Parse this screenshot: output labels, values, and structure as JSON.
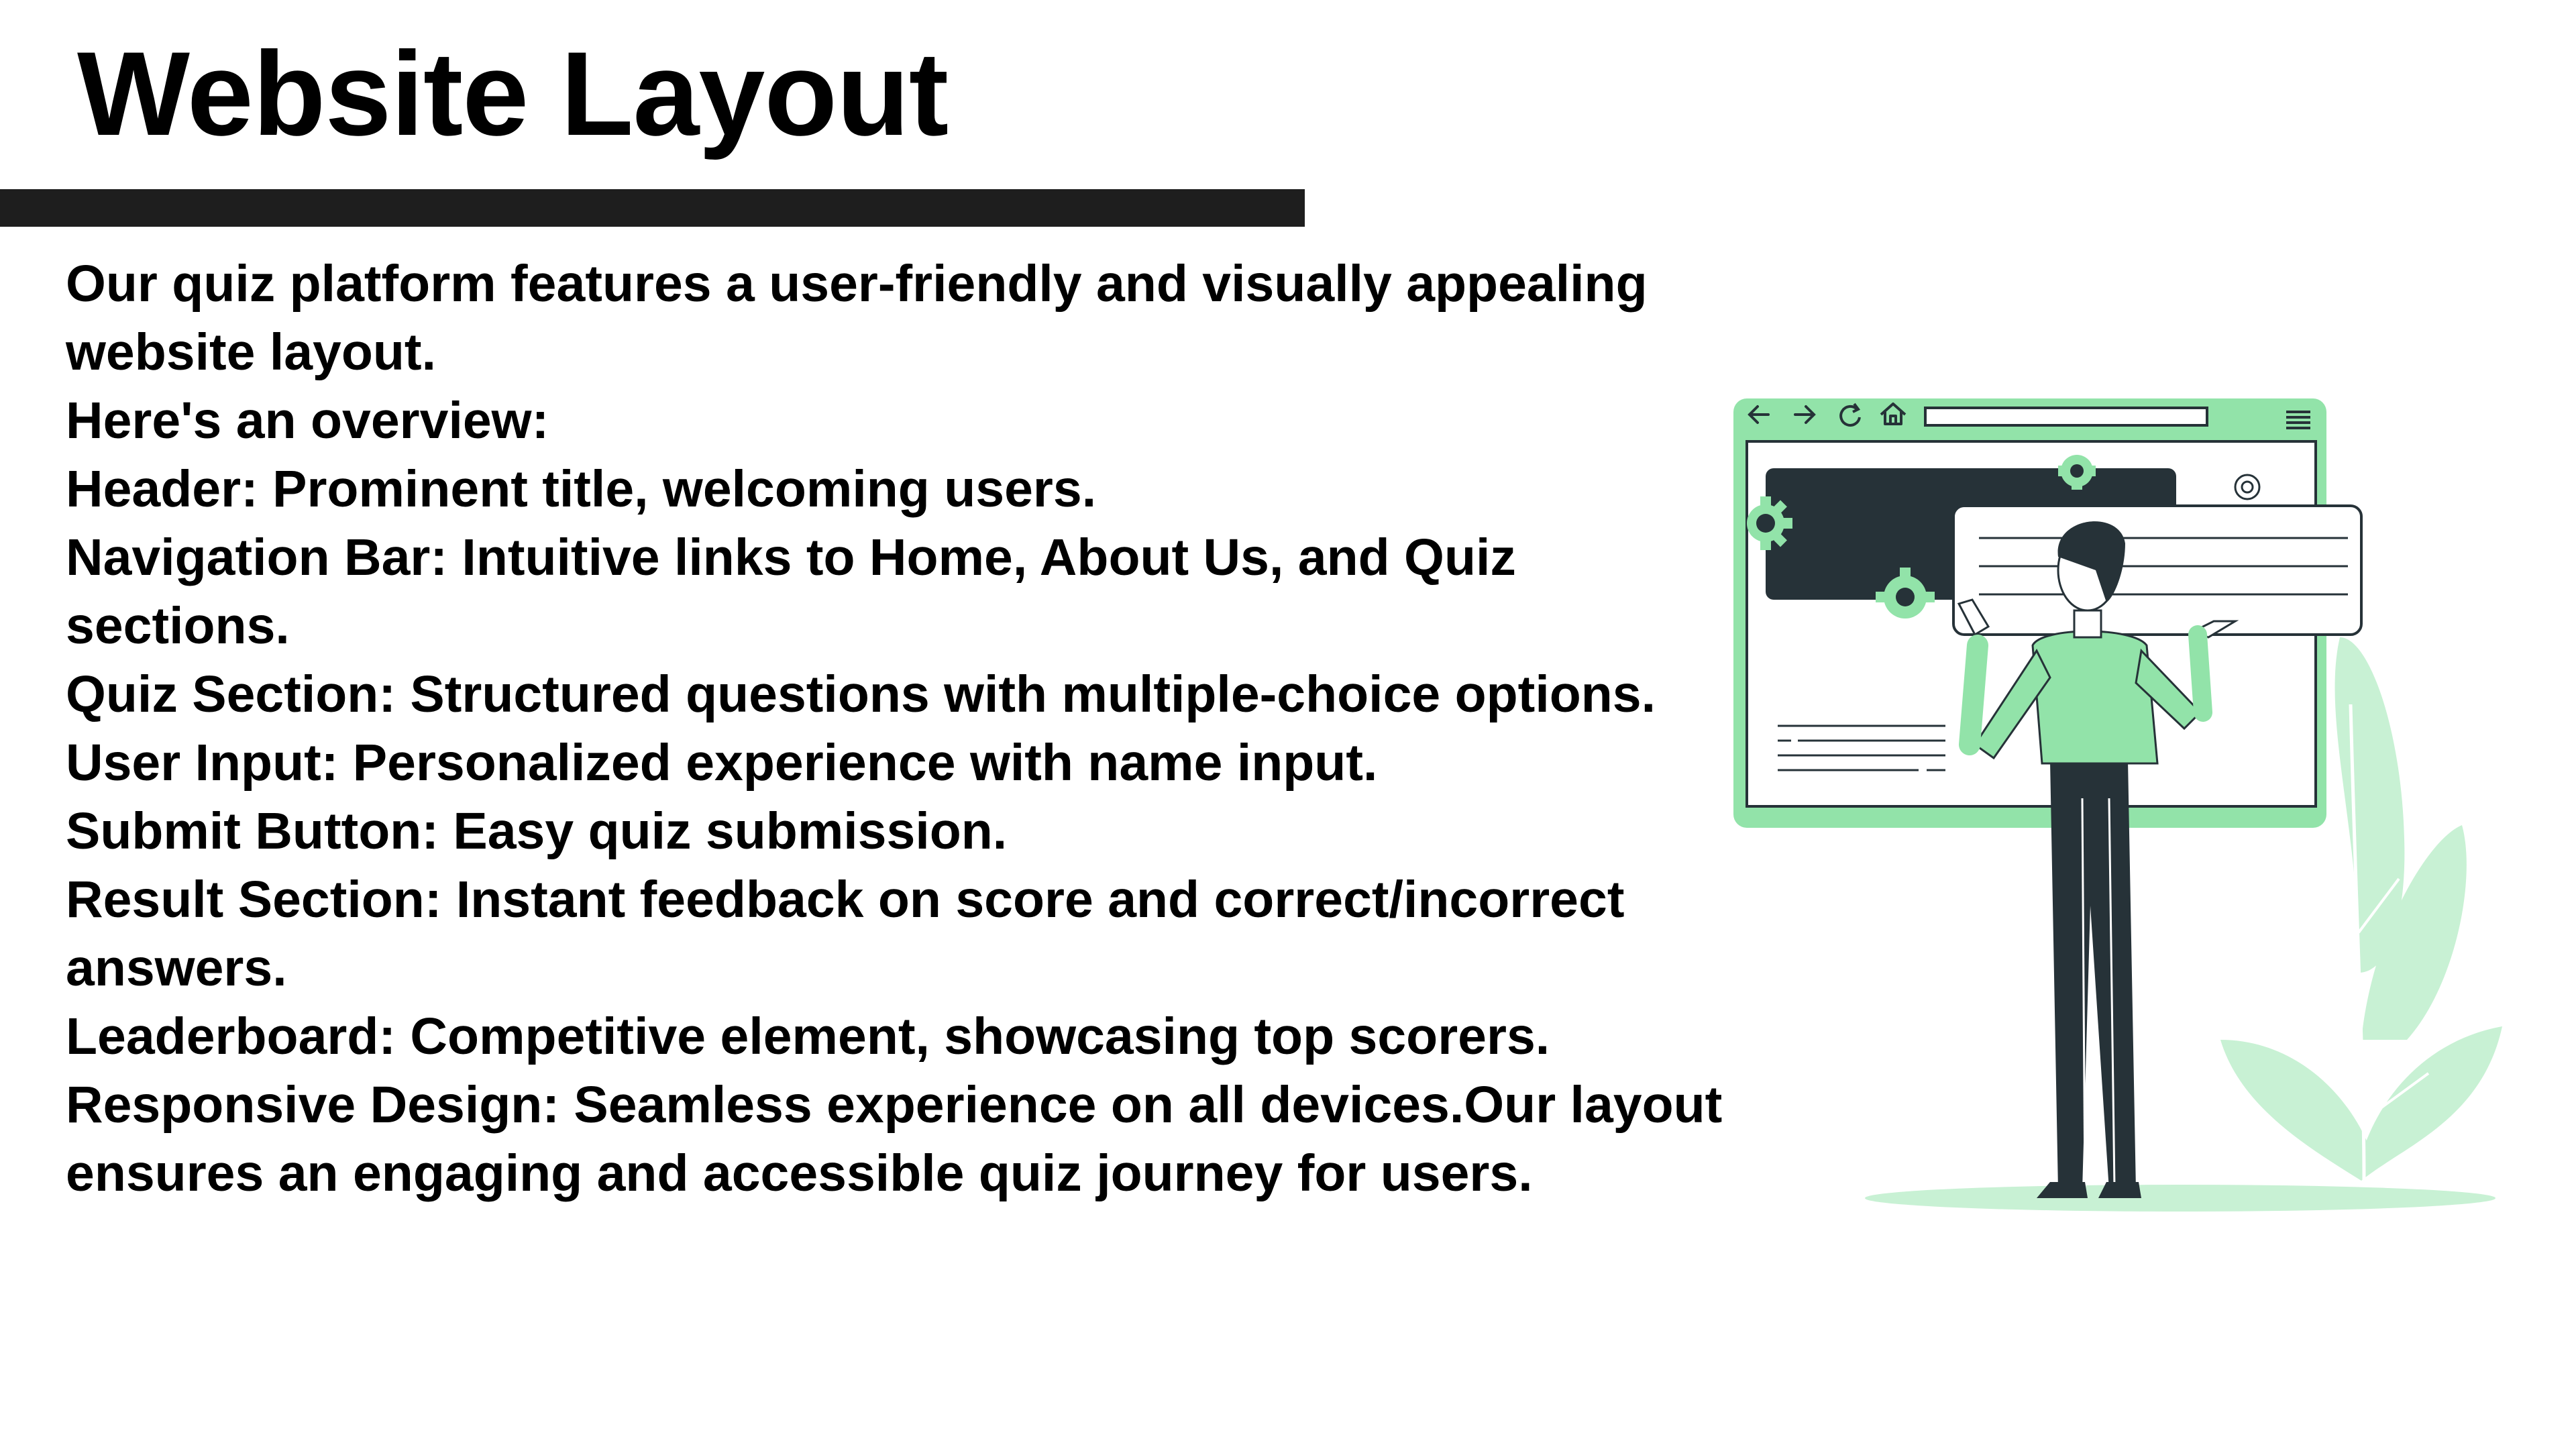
{
  "slide": {
    "title": "Website Layout",
    "lines": [
      "Our quiz platform features a user-friendly and visually appealing",
      "website layout.",
      "Here's an overview:",
      "Header: Prominent title, welcoming users.",
      "Navigation Bar: Intuitive links to Home, About Us, and Quiz",
      "sections.",
      "Quiz Section: Structured questions with multiple-choice options.",
      "User Input: Personalized experience with name input.",
      "Submit Button: Easy quiz submission.",
      "Result Section: Instant feedback on score and correct/incorrect",
      "answers.",
      "Leaderboard: Competitive element, showcasing top scorers.",
      "Responsive Design: Seamless experience on all devices.Our layout",
      "ensures an engaging and accessible quiz journey for users."
    ]
  },
  "colors": {
    "accent_green": "#92e3a9",
    "light_green": "#c8f1d4",
    "dark": "#263238",
    "title_bar": "#1e1e1e"
  },
  "icons": [
    "back-arrow-icon",
    "forward-arrow-icon",
    "reload-icon",
    "home-icon",
    "menu-icon",
    "gear-icon"
  ]
}
